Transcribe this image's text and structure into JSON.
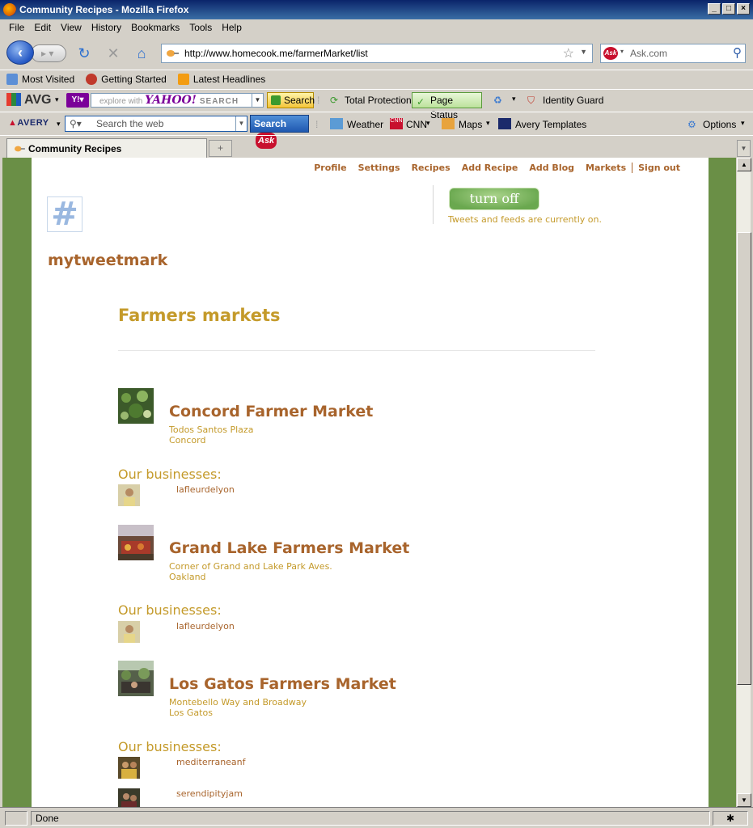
{
  "window": {
    "title": "Community Recipes - Mozilla Firefox"
  },
  "menu": [
    "File",
    "Edit",
    "View",
    "History",
    "Bookmarks",
    "Tools",
    "Help"
  ],
  "nav": {
    "url": "http://www.homecook.me/farmerMarket/list",
    "search_placeholder": "Ask.com"
  },
  "bookmarks": [
    "Most Visited",
    "Getting Started",
    "Latest Headlines"
  ],
  "avg_toolbar": {
    "logo": "AVG",
    "yahoo_hint": "explore with",
    "yahoo_brand": "YAHOO!",
    "yahoo_search": "SEARCH",
    "search_button": "Search",
    "total_protection": "Total Protection",
    "page_status": "Page Status",
    "identity_guard": "Identity Guard"
  },
  "ask_toolbar": {
    "logo": "AVERY",
    "search_placeholder": "Search the web",
    "search_button": "Search",
    "ask_badge": "Ask",
    "weather": "Weather",
    "cnn": "CNN",
    "maps": "Maps",
    "avery_templates": "Avery Templates",
    "options": "Options"
  },
  "tab": {
    "title": "Community Recipes"
  },
  "page": {
    "top_links": [
      "Profile",
      "Settings",
      "Recipes",
      "Add Recipe",
      "Add Blog",
      "Markets",
      "Sign out"
    ],
    "turn_off": "turn off",
    "tweet_status": "Tweets and feeds are currently on.",
    "username": "mytweetmark",
    "section_title": "Farmers markets",
    "businesses_heading": "Our businesses:",
    "markets": [
      {
        "name": "Concord Farmer Market",
        "address1": "Todos Santos Plaza",
        "address2": "Concord",
        "businesses": [
          "lafleurdelyon"
        ]
      },
      {
        "name": "Grand Lake Farmers Market",
        "address1": "Corner of Grand and Lake Park Aves.",
        "address2": "Oakland",
        "businesses": [
          "lafleurdelyon"
        ]
      },
      {
        "name": "Los Gatos Farmers Market",
        "address1": "Montebello Way and Broadway",
        "address2": "Los Gatos",
        "businesses": [
          "mediterraneanf",
          "serendipityjam"
        ]
      }
    ]
  },
  "status": {
    "text": "Done"
  }
}
